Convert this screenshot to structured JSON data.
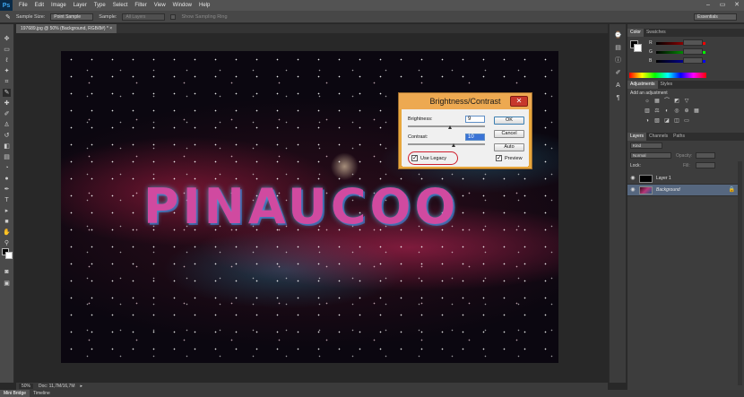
{
  "app": {
    "logo": "Ps"
  },
  "menu": [
    "File",
    "Edit",
    "Image",
    "Layer",
    "Type",
    "Select",
    "Filter",
    "View",
    "Window",
    "Help"
  ],
  "window_controls": [
    "–",
    "▭",
    "✕"
  ],
  "options_bar": {
    "sample_size_label": "Sample Size:",
    "sample_size_value": "Point Sample",
    "sample_label": "Sample:",
    "sample_value": "All Layers",
    "show_ring_label": "Show Sampling Ring",
    "workspace": "Essentials"
  },
  "document_tab": "197689.jpg @ 50% (Background, RGB/8#) *  ×",
  "canvas_text": "PINAUCOO",
  "dialog": {
    "title": "Brightness/Contrast",
    "close": "✕",
    "brightness_label": "Brightness:",
    "brightness_value": "9",
    "contrast_label": "Contrast:",
    "contrast_value": "10",
    "ok": "OK",
    "cancel": "Cancel",
    "auto": "Auto",
    "use_legacy": "Use Legacy",
    "use_legacy_checked": true,
    "preview": "Preview",
    "preview_checked": true
  },
  "status": {
    "zoom": "50%",
    "doc": "Doc: 11,7M/16,7M"
  },
  "bottom_tabs": [
    "Mini Bridge",
    "Timeline"
  ],
  "panels": {
    "color_tabs": [
      "Color",
      "Swatches"
    ],
    "color_rows": [
      "R",
      "G",
      "B"
    ],
    "adjust_tabs": [
      "Adjustments",
      "Styles"
    ],
    "add_adjustment": "Add an adjustment",
    "layers_tabs": [
      "Layers",
      "Channels",
      "Paths"
    ],
    "kind_label": "Kind",
    "blend_mode": "Normal",
    "opacity_label": "Opacity:",
    "lock_label": "Lock:",
    "fill_label": "Fill:",
    "layers": [
      {
        "name": "Layer 1",
        "active": false
      },
      {
        "name": "Background",
        "active": true
      }
    ]
  }
}
